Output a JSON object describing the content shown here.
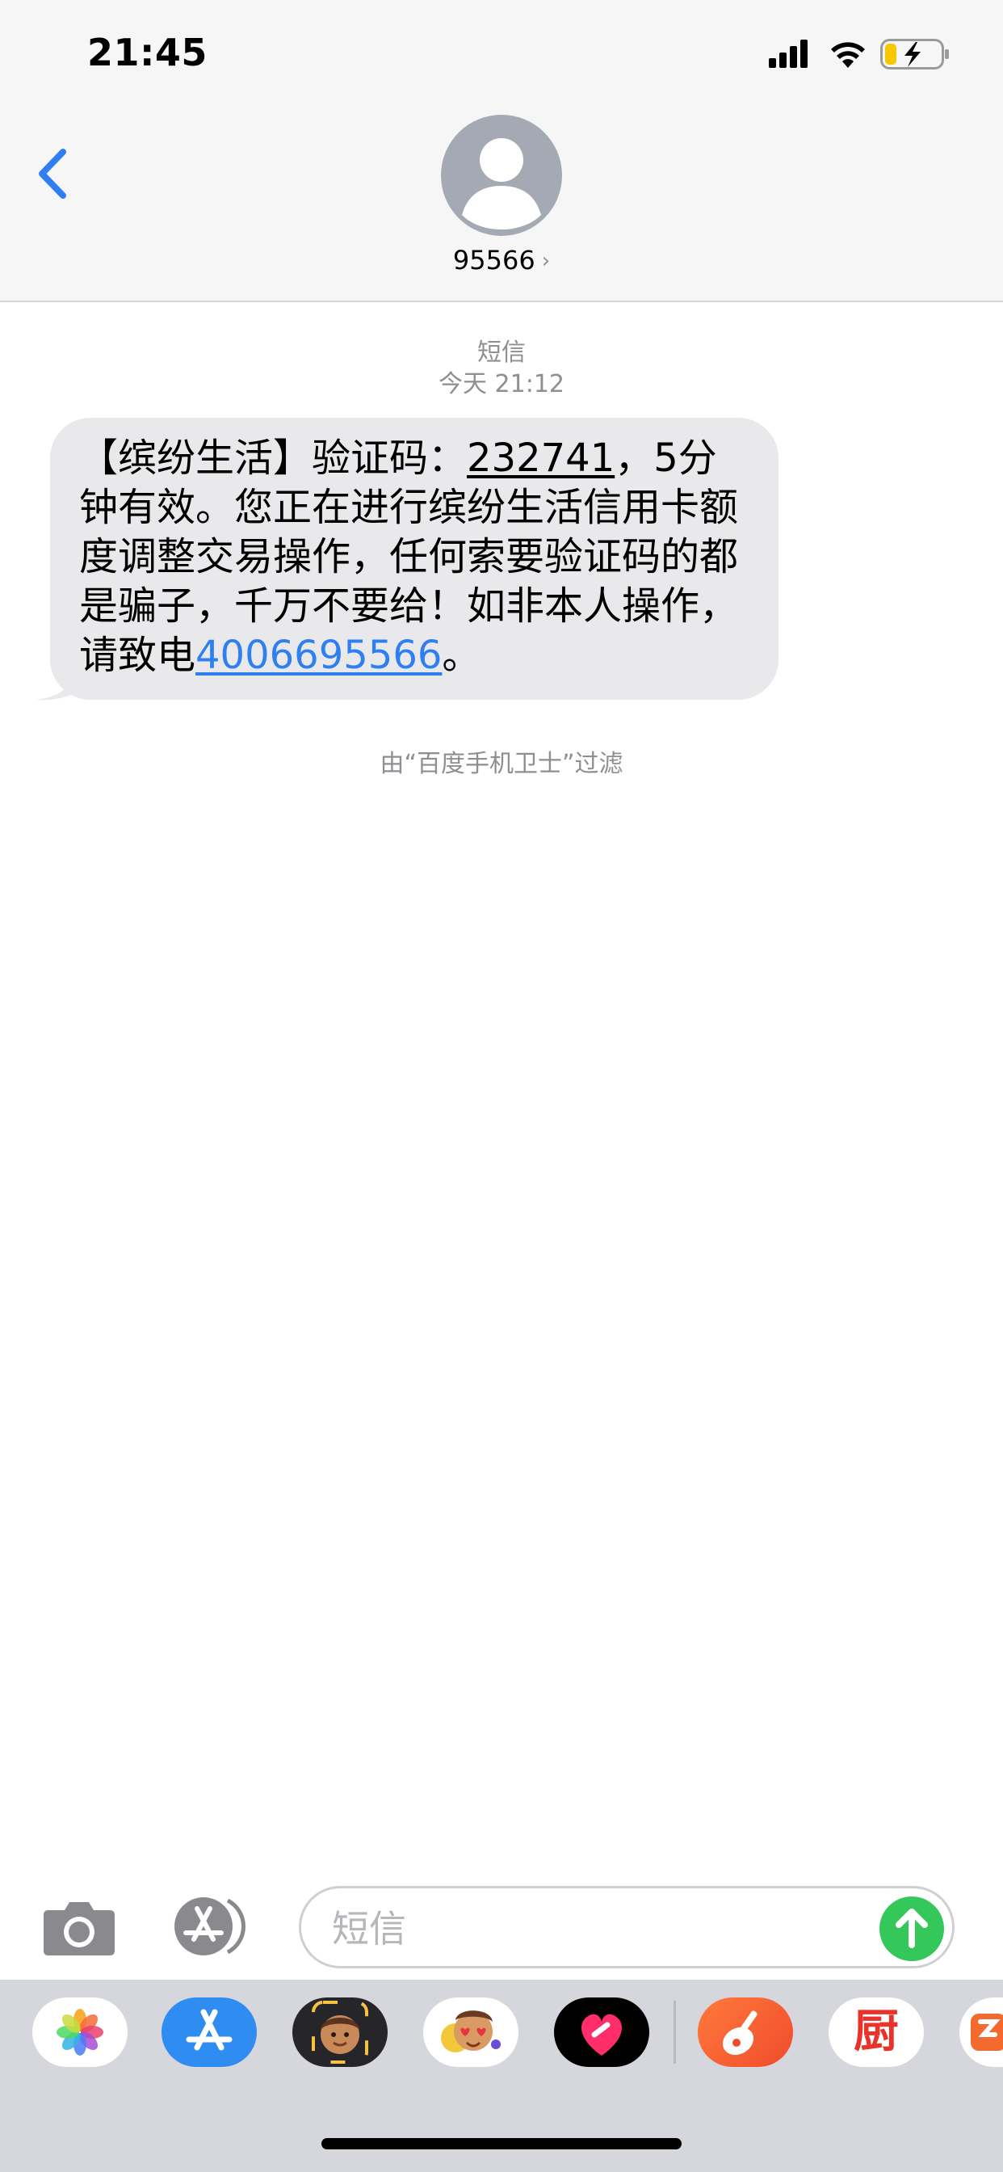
{
  "status_bar": {
    "time": "21:45",
    "icons": [
      "signal-icon",
      "wifi-icon",
      "battery-charging-icon"
    ]
  },
  "header": {
    "back_icon": "chevron-left-icon",
    "contact_name": "95566",
    "contact_chevron": "›"
  },
  "conversation": {
    "service_label": "短信",
    "timestamp": "今天 21:12",
    "message": {
      "part1": "【缤纷生活】验证码：",
      "code": "232741",
      "part2": "，5分钟有效。您正在进行缤纷生活信用卡额度调整交易操作，任何索要验证码的都是骗子，千万不要给！如非本人操作，请致电",
      "phone": "4006695566",
      "part3": "。"
    },
    "filter_note": "由“百度手机卫士”过滤"
  },
  "input_bar": {
    "placeholder": "短信",
    "camera_icon": "camera-icon",
    "appstore_icon": "app-store-icon",
    "send_icon": "arrow-up-icon"
  },
  "app_drawer": {
    "apps": [
      "photos",
      "app-store",
      "memoji",
      "animoji-stickers",
      "digital-touch",
      "garageband",
      "kitchen-app",
      "partial-app"
    ],
    "kitchen_app_glyph": "厨"
  },
  "colors": {
    "accent_blue": "#2f7ff3",
    "send_green": "#34c759",
    "bubble_gray": "#e9e9eb",
    "secondary_text": "#8e8e93"
  }
}
